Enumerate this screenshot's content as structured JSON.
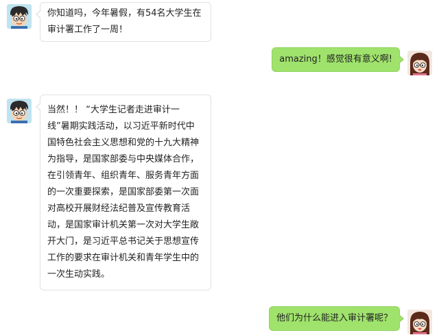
{
  "colors": {
    "sent_bubble": "#9fe26c",
    "received_bubble": "#ffffff",
    "received_border": "#e1e1e1"
  },
  "messages": [
    {
      "sender": "boy",
      "side": "left",
      "avatar_icon": "boy-avatar-icon",
      "text": "你知道吗，今年暑假，有54名大学生在\n审计署工作了一周！"
    },
    {
      "sender": "girl",
      "side": "right",
      "avatar_icon": "girl-avatar-icon",
      "text": "amazing！感觉很有意义啊!"
    },
    {
      "sender": "boy",
      "side": "left",
      "avatar_icon": "boy-avatar-icon",
      "text": "当然！！ “大学生记者走进审计一\n线”暑期实践活动，以习近平新时代中\n国特色社会主义思想和党的十九大精神\n为指导，是国家部委与中央媒体合作，\n在引领青年、组织青年、服务青年方面\n的一次重要探索，是国家部委第一次面\n对高校开展财经法纪普及宣传教育活\n动，是国家审计机关第一次对大学生敞\n开大门，是习近平总书记关于思想宣传\n工作的要求在审计机关和青年学生中的\n一次生动实践。"
    },
    {
      "sender": "girl",
      "side": "right",
      "avatar_icon": "girl-avatar-icon",
      "text": "他们为什么能进入审计署呢？"
    }
  ]
}
